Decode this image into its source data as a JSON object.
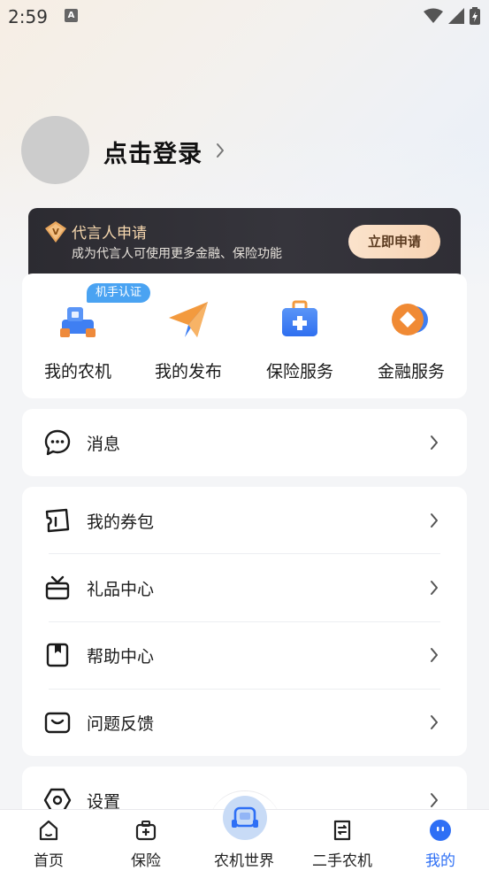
{
  "status_bar": {
    "time": "2:59",
    "notif_letter": "A"
  },
  "profile": {
    "login_text": "点击登录"
  },
  "banner": {
    "title": "代言人申请",
    "subtitle": "成为代言人可使用更多金融、保险功能",
    "button": "立即申请",
    "colors": {
      "title": "#f6d7ae",
      "button_bg": "#f7d3b3"
    }
  },
  "services": {
    "badge": "机手认证",
    "items": [
      {
        "label": "我的农机",
        "icon": "tractor-icon"
      },
      {
        "label": "我的发布",
        "icon": "paper-plane-icon"
      },
      {
        "label": "保险服务",
        "icon": "medical-kit-icon"
      },
      {
        "label": "金融服务",
        "icon": "coin-icon"
      }
    ]
  },
  "menu": {
    "message": {
      "label": "消息",
      "icon": "chat-bubble-icon"
    },
    "group": [
      {
        "label": "我的券包",
        "icon": "ticket-icon"
      },
      {
        "label": "礼品中心",
        "icon": "gift-icon"
      },
      {
        "label": "帮助中心",
        "icon": "book-icon"
      },
      {
        "label": "问题反馈",
        "icon": "feedback-icon"
      }
    ],
    "settings": {
      "label": "设置",
      "icon": "settings-icon"
    }
  },
  "tabbar": {
    "items": [
      {
        "label": "首页",
        "icon": "home-icon"
      },
      {
        "label": "保险",
        "icon": "insurance-icon"
      },
      {
        "label": "农机世界",
        "icon": "machine-icon"
      },
      {
        "label": "二手农机",
        "icon": "used-machine-icon"
      },
      {
        "label": "我的",
        "icon": "profile-face-icon"
      }
    ],
    "active_index": 4,
    "active_color": "#2e6ff5"
  }
}
